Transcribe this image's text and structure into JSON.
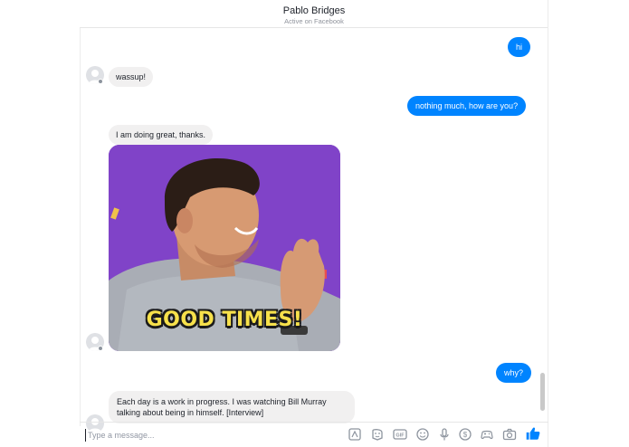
{
  "header": {
    "name": "Pablo Bridges",
    "status": "Active on Facebook"
  },
  "messages": [
    {
      "from": "me",
      "text": "hi"
    },
    {
      "from": "contact",
      "text": "wassup!"
    },
    {
      "from": "me",
      "text": "nothing much, how are you?"
    },
    {
      "from": "contact",
      "text": "I am doing great, thanks."
    },
    {
      "from": "contact",
      "type": "gif",
      "caption": "GOOD TIMES!"
    },
    {
      "from": "me",
      "text": "why?"
    },
    {
      "from": "contact",
      "text": "Each day is a work in progress. I was watching Bill Murray talking about being in himself. [Interview]"
    }
  ],
  "composer": {
    "placeholder": "Type a message...",
    "tools": [
      "sticker-icon",
      "emoji-face-icon",
      "gif-icon",
      "smiley-icon",
      "microphone-icon",
      "payment-icon",
      "game-controller-icon",
      "camera-icon",
      "thumbs-up-icon"
    ]
  },
  "colors": {
    "accent": "#0084ff",
    "incoming_bubble": "#f1f0f0",
    "gif_background": "#7b3fc4",
    "gif_caption": "#f7e14b"
  }
}
